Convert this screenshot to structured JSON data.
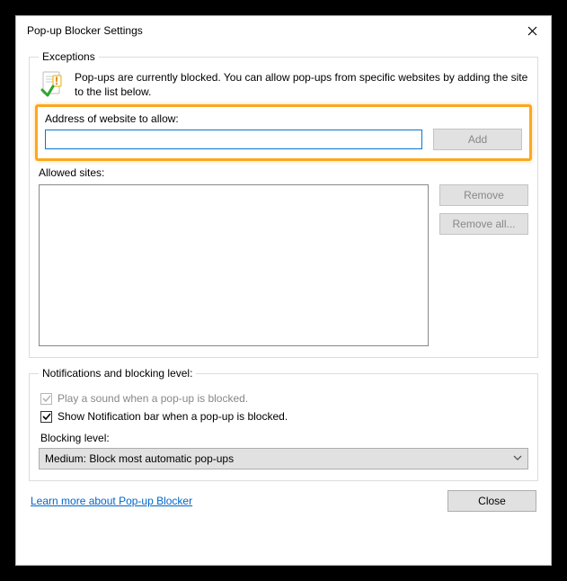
{
  "window": {
    "title": "Pop-up Blocker Settings"
  },
  "exceptions": {
    "legend": "Exceptions",
    "intro": "Pop-ups are currently blocked.  You can allow pop-ups from specific websites by adding the site to the list below.",
    "address_label": "Address of website to allow:",
    "address_value": "",
    "add_label": "Add",
    "allowed_label": "Allowed sites:",
    "remove_label": "Remove",
    "remove_all_label": "Remove all..."
  },
  "notifications": {
    "legend": "Notifications and blocking level:",
    "sound_label": "Play a sound when a pop-up is blocked.",
    "sound_checked": true,
    "sound_disabled": true,
    "bar_label": "Show Notification bar when a pop-up is blocked.",
    "bar_checked": true,
    "blocking_label": "Blocking level:",
    "blocking_value": "Medium: Block most automatic pop-ups"
  },
  "footer": {
    "link": "Learn more about Pop-up Blocker",
    "close": "Close"
  }
}
